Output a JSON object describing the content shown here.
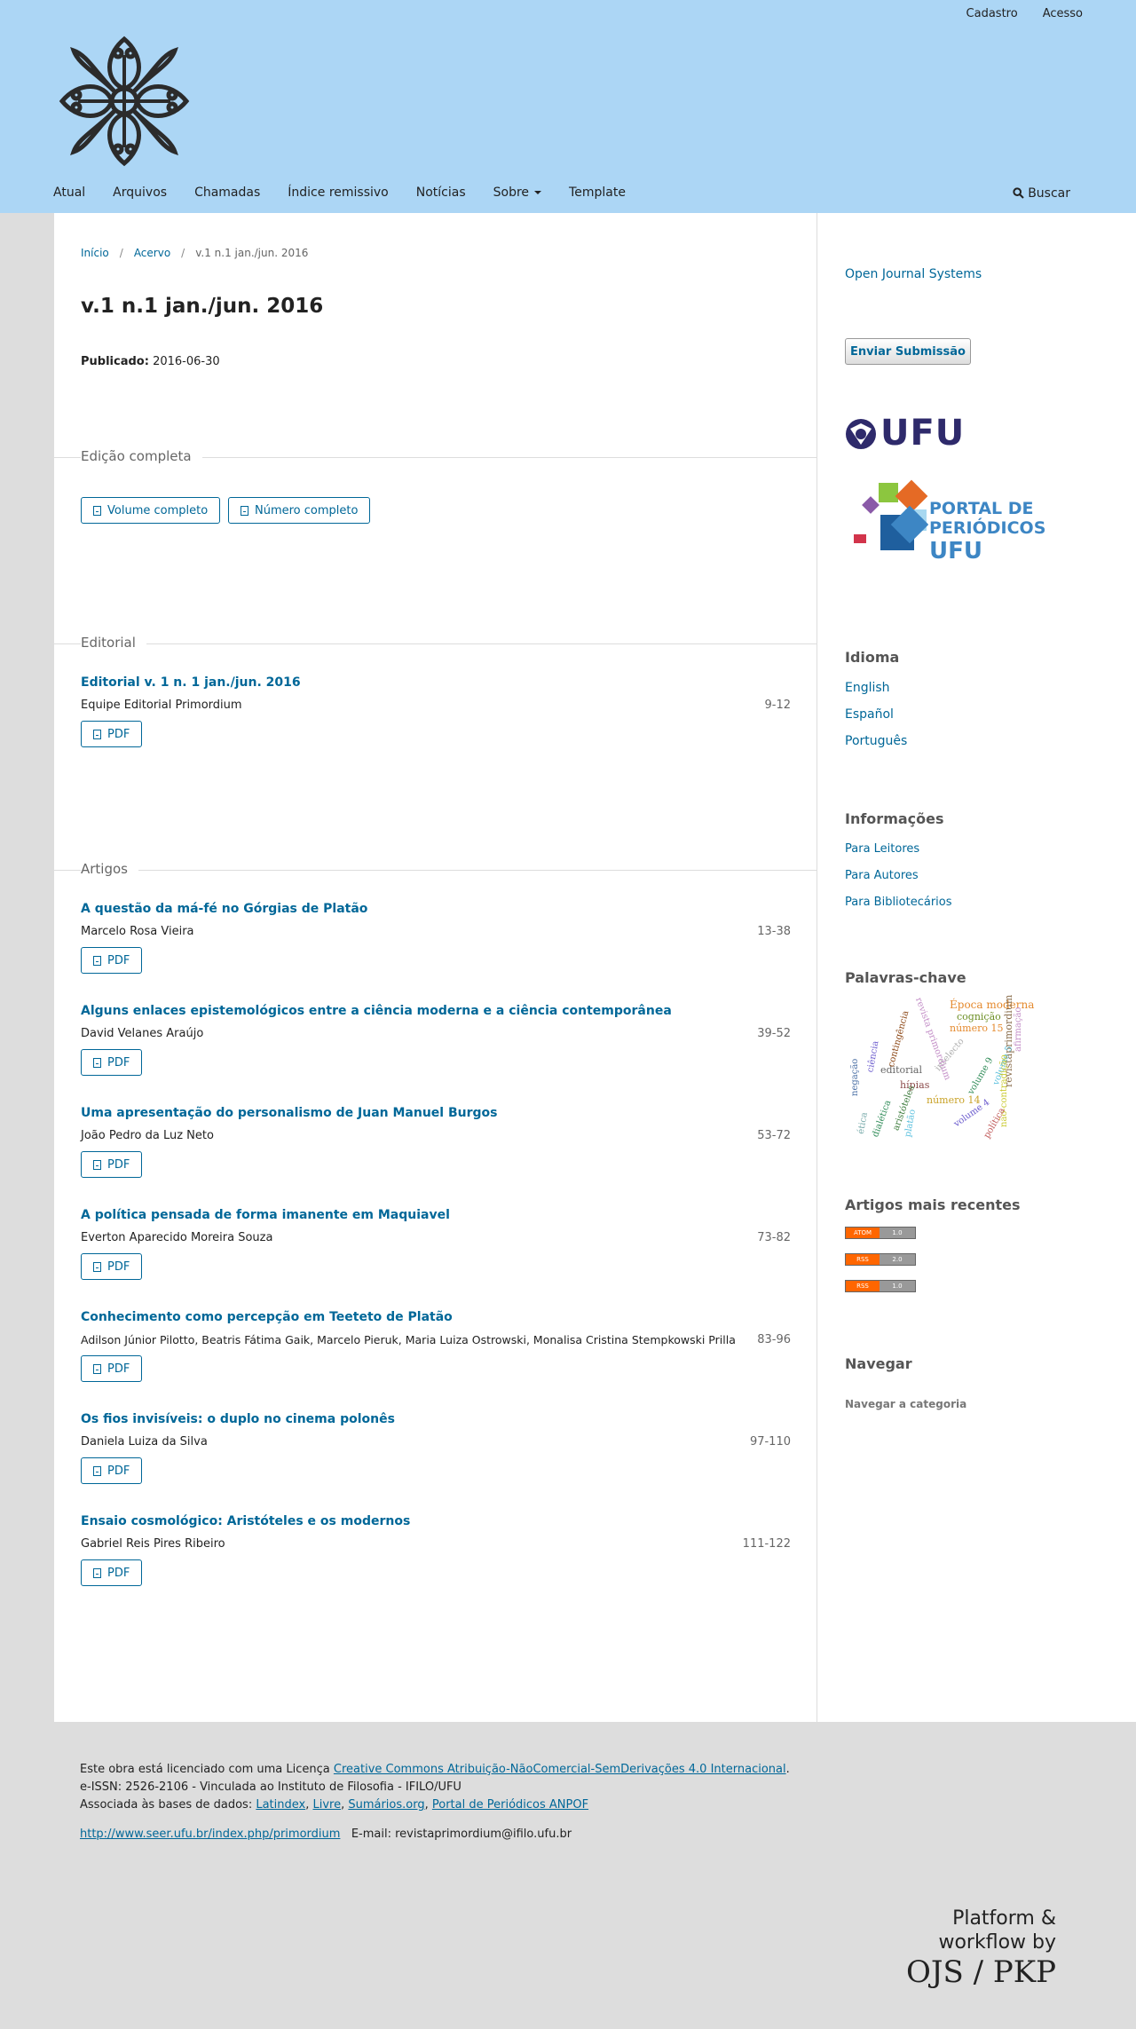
{
  "user_nav": {
    "register": "Cadastro",
    "login": "Acesso"
  },
  "main_nav": {
    "items": [
      "Atual",
      "Arquivos",
      "Chamadas",
      "Índice remissivo",
      "Notícias",
      "Sobre",
      "Template"
    ],
    "search": "Buscar"
  },
  "breadcrumb": {
    "home": "Início",
    "archive": "Acervo",
    "current": "v.1 n.1 jan./jun. 2016"
  },
  "issue": {
    "title": "v.1 n.1 jan./jun. 2016",
    "published_label": "Publicado:",
    "published_date": "2016-06-30"
  },
  "full_edition": {
    "heading": "Edição completa",
    "buttons": [
      "Volume completo",
      "Número completo"
    ]
  },
  "editorial": {
    "heading": "Editorial",
    "article": {
      "title": "Editorial v. 1 n. 1 jan./jun. 2016",
      "authors": "Equipe Editorial Primordium",
      "pages": "9-12",
      "galley": "PDF"
    }
  },
  "articles": {
    "heading": "Artigos",
    "items": [
      {
        "title": "A questão da má-fé no Górgias de Platão",
        "authors": "Marcelo Rosa Vieira",
        "pages": "13-38",
        "galley": "PDF"
      },
      {
        "title": "Alguns enlaces epistemológicos entre a ciência moderna e a ciência contemporânea",
        "authors": "David Velanes Araújo",
        "pages": "39-52",
        "galley": "PDF"
      },
      {
        "title": "Uma apresentação do personalismo de Juan Manuel Burgos",
        "authors": "João Pedro da Luz Neto",
        "pages": "53-72",
        "galley": "PDF"
      },
      {
        "title": "A política pensada de forma imanente em Maquiavel",
        "authors": "Everton Aparecido Moreira Souza",
        "pages": "73-82",
        "galley": "PDF"
      },
      {
        "title": "Conhecimento como percepção em Teeteto de Platão",
        "authors": "Adilson Júnior Pilotto, Beatris Fátima Gaik, Marcelo Pieruk, Maria Luiza Ostrowski, Monalisa Cristina Stempkowski Prilla",
        "pages": "83-96",
        "galley": "PDF"
      },
      {
        "title": "Os fios invisíveis: o duplo no cinema polonês",
        "authors": "Daniela Luiza da Silva",
        "pages": "97-110",
        "galley": "PDF"
      },
      {
        "title": "Ensaio cosmológico: Aristóteles e os modernos",
        "authors": "Gabriel Reis Pires Ribeiro",
        "pages": "111-122",
        "galley": "PDF"
      }
    ]
  },
  "sidebar": {
    "ojs_link": "Open Journal Systems",
    "submit_button": "Enviar Submissão",
    "ufu_logo_text": "UFU",
    "portal_logo_text": [
      "PORTAL DE",
      "PERIÓDICOS",
      "UFU"
    ],
    "language": {
      "title": "Idioma",
      "items": [
        "English",
        "Español",
        "Português"
      ]
    },
    "information": {
      "title": "Informações",
      "items": [
        "Para Leitores",
        "Para Autores",
        "Para Bibliotecários"
      ]
    },
    "keywords": {
      "title": "Palavras-chave",
      "words": [
        "Época moderna",
        "cognição",
        "número 15",
        "revistaprimordium",
        "editorial",
        "hípias",
        "número 14",
        "volume 4",
        "volume 5",
        "volume 9",
        "intelecto",
        "não-contradição",
        "afirmação",
        "negação",
        "dialética",
        "ética",
        "platão",
        "política",
        "ciência",
        "contingência",
        "aristóteles",
        "revista primordium"
      ]
    },
    "recent": {
      "title": "Artigos mais recentes",
      "feeds": [
        [
          "ATOM",
          "1.0"
        ],
        [
          "RSS",
          "2.0"
        ],
        [
          "RSS",
          "1.0"
        ]
      ]
    },
    "browse": {
      "title": "Navegar",
      "item": "Navegar a categoria"
    }
  },
  "footer": {
    "license_prefix": "Este obra está licenciado com uma Licença ",
    "license_link": "Creative Commons Atribuição-NãoComercial-SemDerivações 4.0 Internacional",
    "license_suffix": ".",
    "issn_line": "e-ISSN: 2526-2106 - Vinculada ao  Instituto de Filosofia - IFILO/UFU",
    "databases_prefix": "Associada às bases de dados: ",
    "databases": [
      "Latindex",
      "Livre",
      "Sumários.org",
      "Portal de Periódicos ANPOF"
    ],
    "url": "http://www.seer.ufu.br/index.php/primordium",
    "email": "E-mail: revistaprimordium@ifilo.ufu.br",
    "pkp_line1": "Platform &",
    "pkp_line2": "workflow by",
    "pkp_brand": "OJS / PKP"
  },
  "colors": {
    "header_bg": "#acd6f5",
    "link": "#006798",
    "footer_bg": "#dddddd"
  }
}
